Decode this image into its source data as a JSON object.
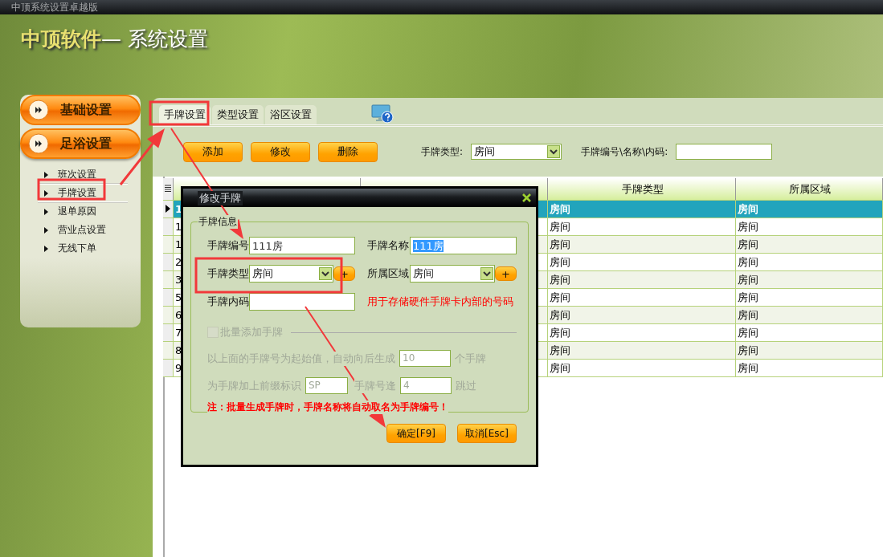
{
  "window": {
    "title": "中顶系统设置卓越版"
  },
  "header": {
    "brand": "中顶软件",
    "title": "— 系统设置"
  },
  "sidebar": {
    "sections": [
      {
        "label": "基础设置",
        "expanded": false
      },
      {
        "label": "足浴设置",
        "expanded": true,
        "items": [
          {
            "label": "班次设置",
            "selected": false
          },
          {
            "label": "手牌设置",
            "selected": true
          },
          {
            "label": "退单原因",
            "selected": false
          },
          {
            "label": "营业点设置",
            "selected": false
          },
          {
            "label": "无线下单",
            "selected": false
          }
        ]
      }
    ]
  },
  "tabs": [
    {
      "label": "手牌设置",
      "selected": true
    },
    {
      "label": "类型设置",
      "selected": false
    },
    {
      "label": "浴区设置",
      "selected": false
    }
  ],
  "toolbar": {
    "buttons": [
      "添加",
      "修改",
      "删除"
    ],
    "type_filter": {
      "label": "手牌类型:",
      "value": "房间"
    },
    "search": {
      "label": "手牌编号\\名称\\内码:"
    }
  },
  "table": {
    "columns": [
      "手牌类型",
      "所属区域"
    ],
    "rows": [
      {
        "column_1": "1",
        "cells": [
          "房间",
          "房间"
        ],
        "selected": true
      },
      {
        "column_1": "1",
        "cells": [
          "房间",
          "房间"
        ],
        "selected": false
      },
      {
        "column_1": "1",
        "cells": [
          "房间",
          "房间"
        ],
        "selected": false
      },
      {
        "column_1": "2",
        "cells": [
          "房间",
          "房间"
        ],
        "selected": false
      },
      {
        "column_1": "3",
        "cells": [
          "房间",
          "房间"
        ],
        "selected": false
      },
      {
        "column_1": "5",
        "cells": [
          "房间",
          "房间"
        ],
        "selected": false
      },
      {
        "column_1": "6",
        "cells": [
          "房间",
          "房间"
        ],
        "selected": false
      },
      {
        "column_1": "7",
        "cells": [
          "房间",
          "房间"
        ],
        "selected": false
      },
      {
        "column_1": "8",
        "cells": [
          "房间",
          "房间"
        ],
        "selected": false
      },
      {
        "column_1": "9",
        "cells": [
          "房间",
          "房间"
        ],
        "selected": false
      }
    ]
  },
  "dialog": {
    "title": "修改手牌",
    "group": "手牌信息",
    "fields": [
      {
        "kind": "input",
        "label": "手牌编号",
        "value": "111房",
        "text_selected": false
      },
      {
        "kind": "input",
        "label": "手牌名称",
        "value": "111房",
        "text_selected": true
      },
      {
        "kind": "select",
        "label": "手牌类型",
        "value": "房间",
        "add_button": "+"
      },
      {
        "kind": "select",
        "label": "所属区域",
        "value": "房间",
        "add_button": "+"
      },
      {
        "kind": "input",
        "label": "手牌内码"
      },
      {
        "kind": "hint",
        "label": "用于存储硬件手牌卡内部的号码"
      }
    ],
    "batch": {
      "label": "批量添加手牌",
      "checked": false,
      "disabled": true,
      "count_before": "以上面的手牌号为起始值，自动向后生成",
      "count_value": "10",
      "count_after": "个手牌",
      "prefix_label": "为手牌加上前缀标识",
      "prefix_value": "SP",
      "skip_label": "手牌号逢",
      "skip_value": "4",
      "skip_after": "跳过"
    },
    "note": "注：批量生成手牌时，手牌名称将自动取名为手牌编号！",
    "buttons": [
      "确定[F9]",
      "取消[Esc]"
    ]
  }
}
